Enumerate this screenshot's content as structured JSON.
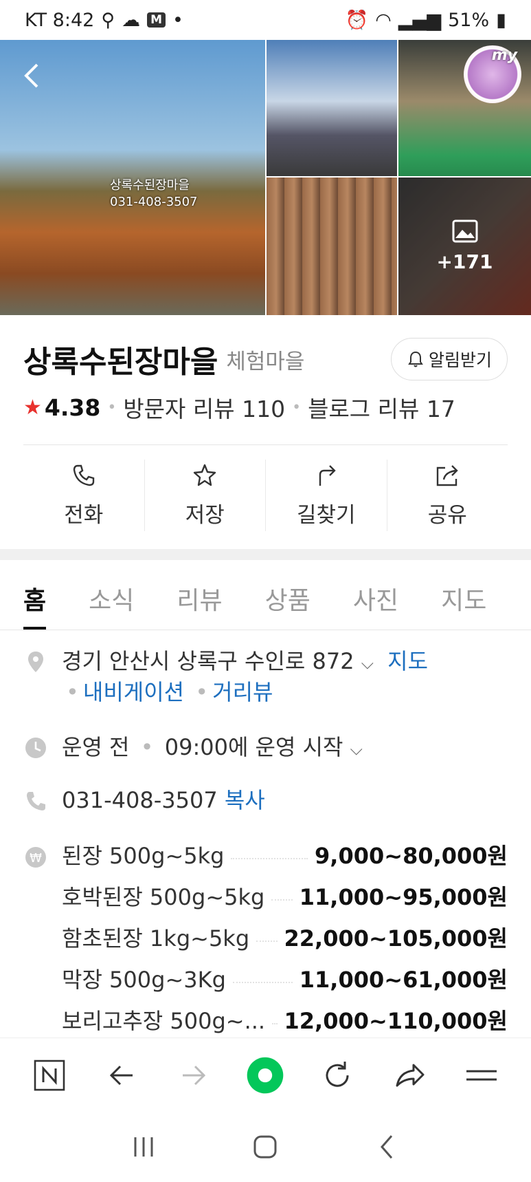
{
  "status_bar": {
    "carrier_time": "KT 8:42",
    "badge": "M",
    "battery": "51%"
  },
  "gallery": {
    "sign_line1": "상록수된장마을",
    "sign_line2": "031-408-3507",
    "more_count": "+171",
    "badge_text": "my"
  },
  "place": {
    "name": "상록수된장마을",
    "category": "체험마을",
    "alarm_label": "알림받기",
    "rating": "4.38",
    "visitor_reviews": "방문자 리뷰 110",
    "blog_reviews": "블로그 리뷰 17"
  },
  "actions": [
    {
      "label": "전화",
      "icon": "phone-icon"
    },
    {
      "label": "저장",
      "icon": "star-icon"
    },
    {
      "label": "길찾기",
      "icon": "directions-icon"
    },
    {
      "label": "공유",
      "icon": "share-icon"
    }
  ],
  "tabs": [
    "홈",
    "소식",
    "리뷰",
    "상품",
    "사진",
    "지도"
  ],
  "info": {
    "address": "경기 안산시 상록구 수인로 872",
    "map_link": "지도",
    "nav_link": "내비게이션",
    "street_link": "거리뷰",
    "hours_status": "운영 전",
    "hours_detail": "09:00에 운영 시작",
    "phone": "031-408-3507",
    "copy_label": "복사"
  },
  "menu": [
    {
      "name": "된장 500g~5kg",
      "price": "9,000~80,000원"
    },
    {
      "name": "호박된장 500g~5kg",
      "price": "11,000~95,000원"
    },
    {
      "name": "함초된장 1kg~5kg",
      "price": "22,000~105,000원"
    },
    {
      "name": "막장 500g~3Kg",
      "price": "11,000~61,000원"
    },
    {
      "name": "보리고추장 500g~...",
      "price": "12,000~110,000원"
    }
  ],
  "colors": {
    "accent_link": "#1d6fbf",
    "star": "#e8322e",
    "home_button": "#03c75a"
  }
}
